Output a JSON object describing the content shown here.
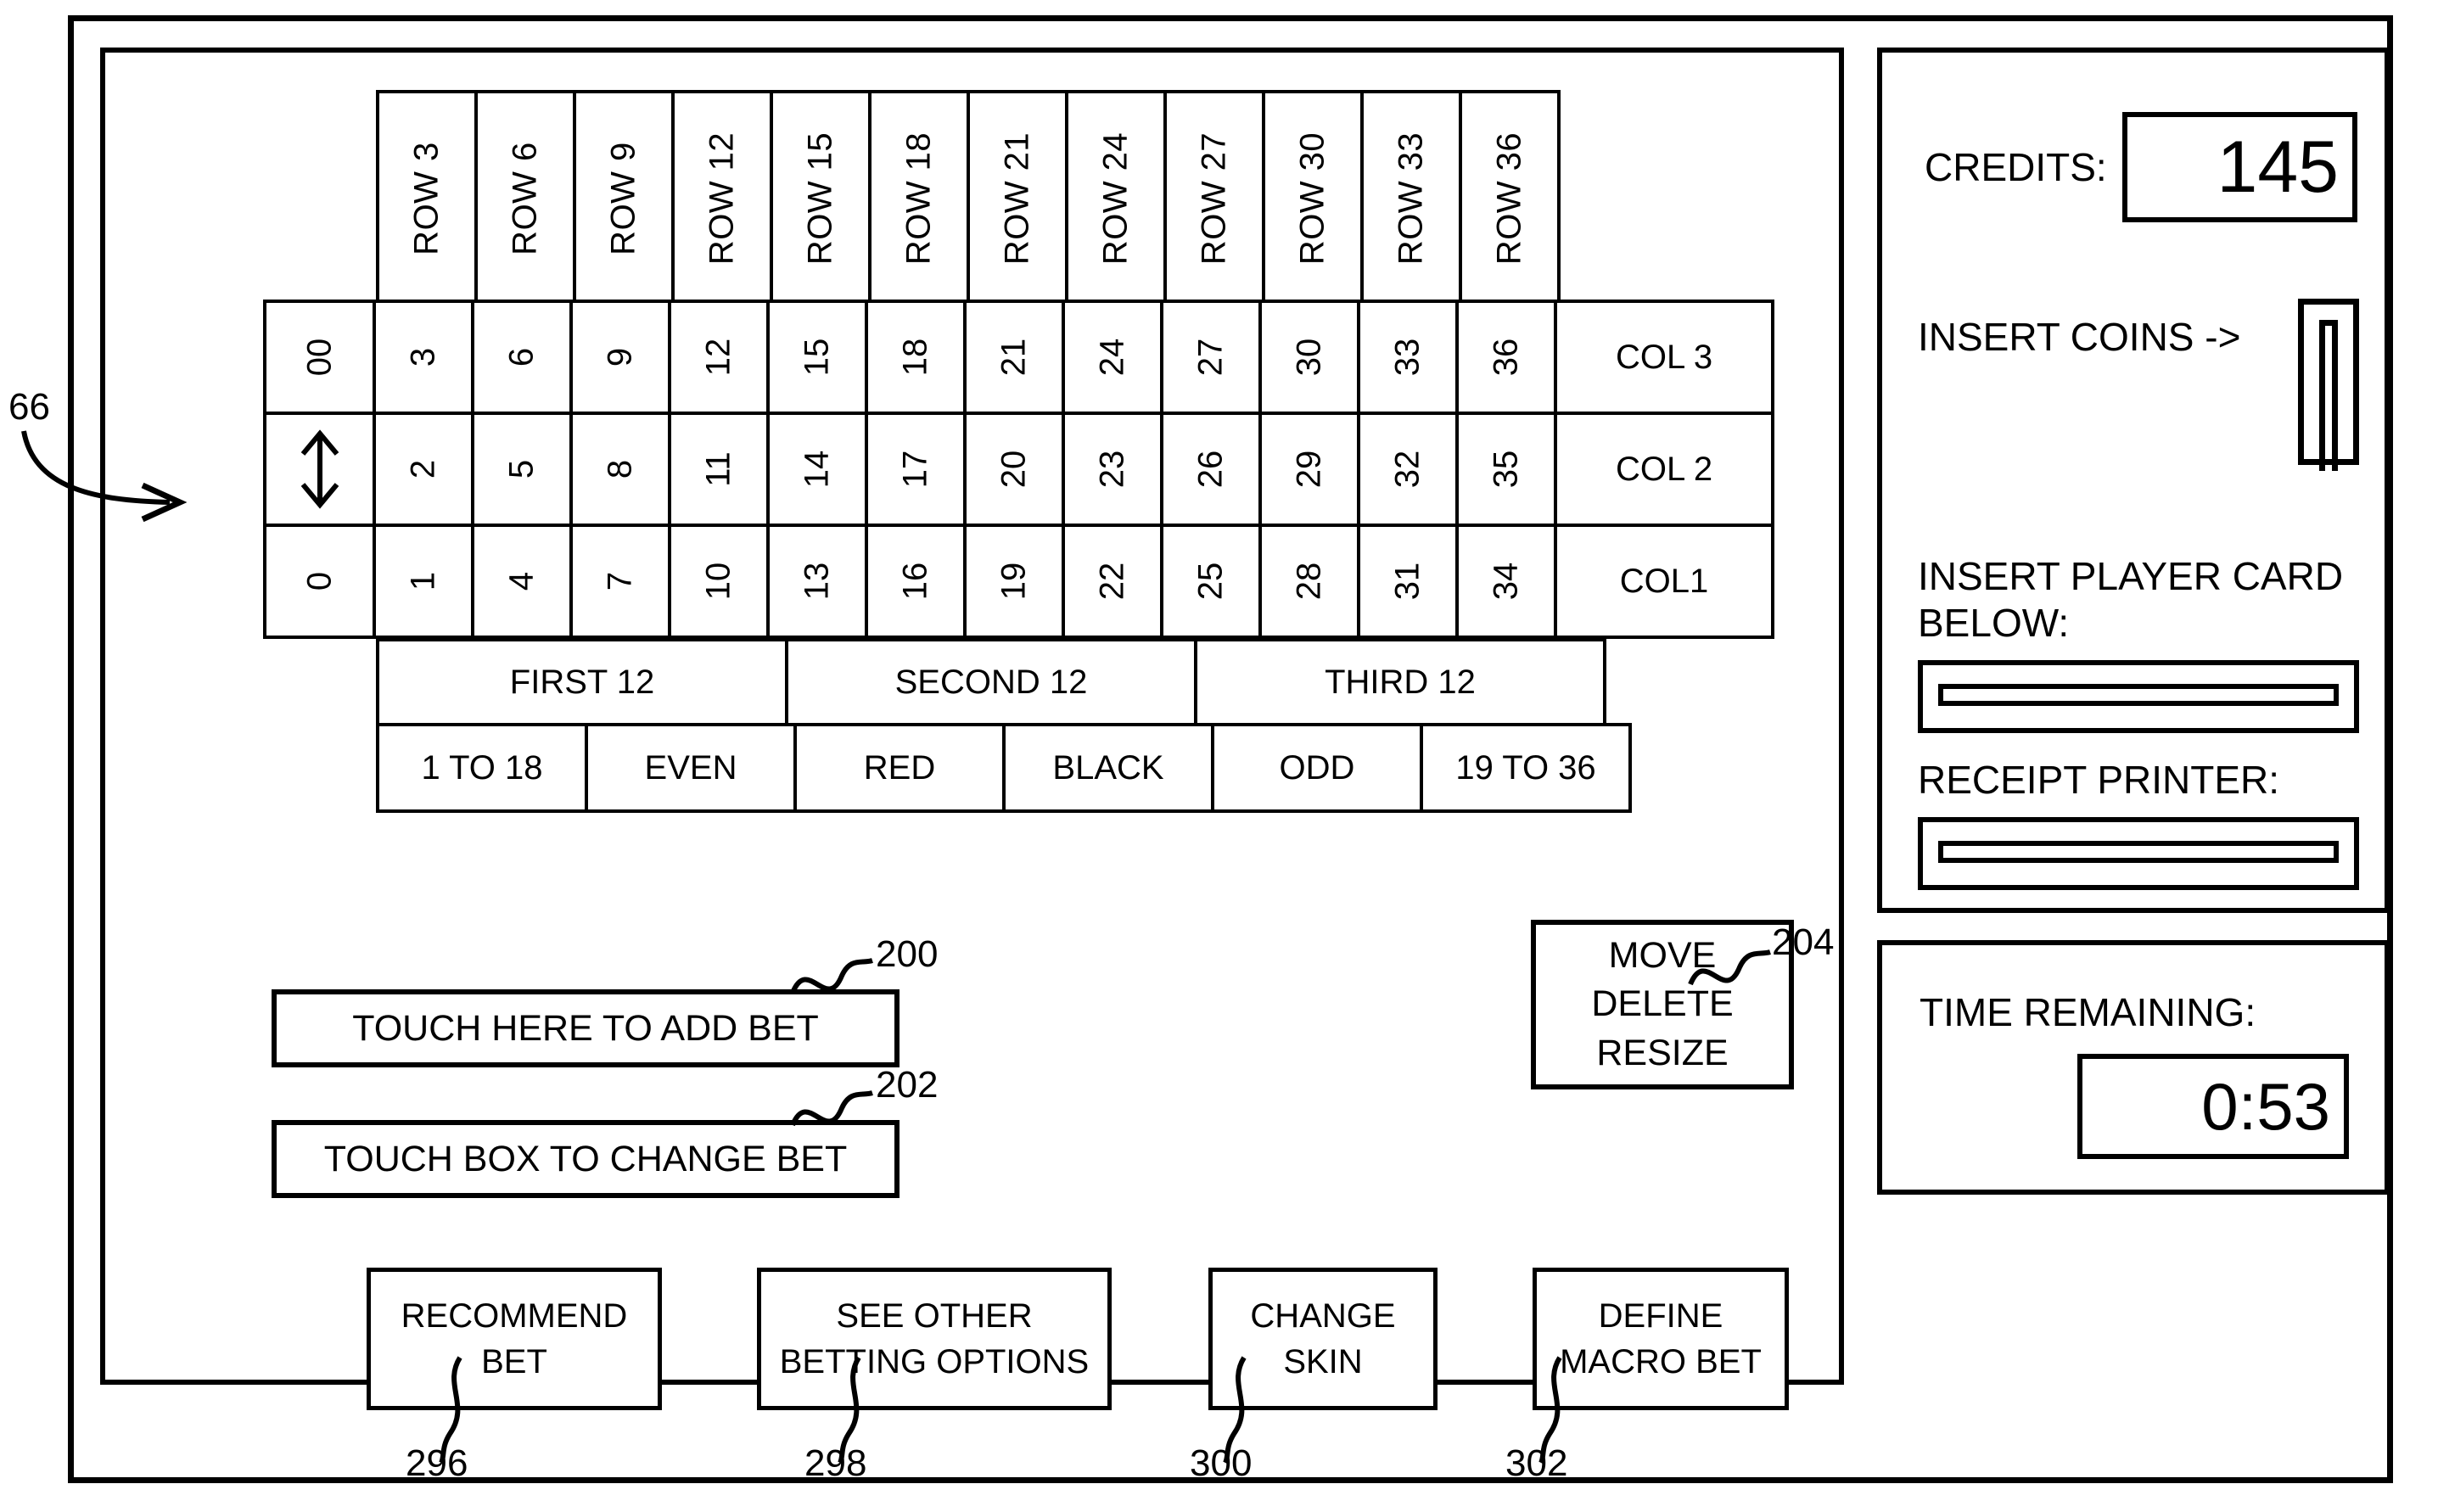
{
  "figure": {
    "callouts": {
      "table": "66",
      "touch_add_bet": "200",
      "touch_change_bet": "202",
      "move_delete_resize": "204",
      "recommend_bet": "296",
      "see_other_betting_options": "298",
      "change_skin": "300",
      "define_macro_bet": "302"
    }
  },
  "betting_table": {
    "row_headers": [
      "ROW 3",
      "ROW 6",
      "ROW 9",
      "ROW 12",
      "ROW 15",
      "ROW 18",
      "ROW 21",
      "ROW 24",
      "ROW 27",
      "ROW 30",
      "ROW 33",
      "ROW 36"
    ],
    "grid_rows": [
      {
        "zero_label": "00",
        "zero_icon": "",
        "numbers": [
          "3",
          "6",
          "9",
          "12",
          "15",
          "18",
          "21",
          "24",
          "27",
          "30",
          "33",
          "36"
        ],
        "col_label": "COL 3"
      },
      {
        "zero_label": "",
        "zero_icon": "up-down-arrow-icon",
        "numbers": [
          "2",
          "5",
          "8",
          "11",
          "14",
          "17",
          "20",
          "23",
          "26",
          "29",
          "32",
          "35"
        ],
        "col_label": "COL 2"
      },
      {
        "zero_label": "0",
        "zero_icon": "",
        "numbers": [
          "1",
          "4",
          "7",
          "10",
          "13",
          "16",
          "19",
          "22",
          "25",
          "28",
          "31",
          "34"
        ],
        "col_label": "COL1"
      }
    ],
    "dozens": [
      "FIRST 12",
      "SECOND 12",
      "THIRD 12"
    ],
    "outside_bets": [
      "1 TO 18",
      "EVEN",
      "RED",
      "BLACK",
      "ODD",
      "19 TO 36"
    ]
  },
  "controls": {
    "touch_add_bet": "TOUCH HERE TO ADD BET",
    "touch_change_bet": "TOUCH BOX TO CHANGE BET",
    "move_delete_resize": [
      "MOVE",
      "DELETE",
      "RESIZE"
    ],
    "options": [
      {
        "line1": "RECOMMEND",
        "line2": "BET"
      },
      {
        "line1": "SEE OTHER",
        "line2": "BETTING OPTIONS"
      },
      {
        "line1": "CHANGE",
        "line2": "SKIN"
      },
      {
        "line1": "DEFINE",
        "line2": "MACRO BET"
      }
    ]
  },
  "machine_panel": {
    "credits_label": "CREDITS:",
    "credits_value": "145",
    "insert_coins_label": "INSERT COINS ->",
    "player_card_label": "INSERT PLAYER CARD\nBELOW:",
    "player_card_label_line1": "INSERT PLAYER CARD",
    "player_card_label_line2": "BELOW:",
    "receipt_printer_label": "RECEIPT PRINTER:"
  },
  "time_panel": {
    "label": "TIME REMAINING:",
    "value": "0:53"
  }
}
